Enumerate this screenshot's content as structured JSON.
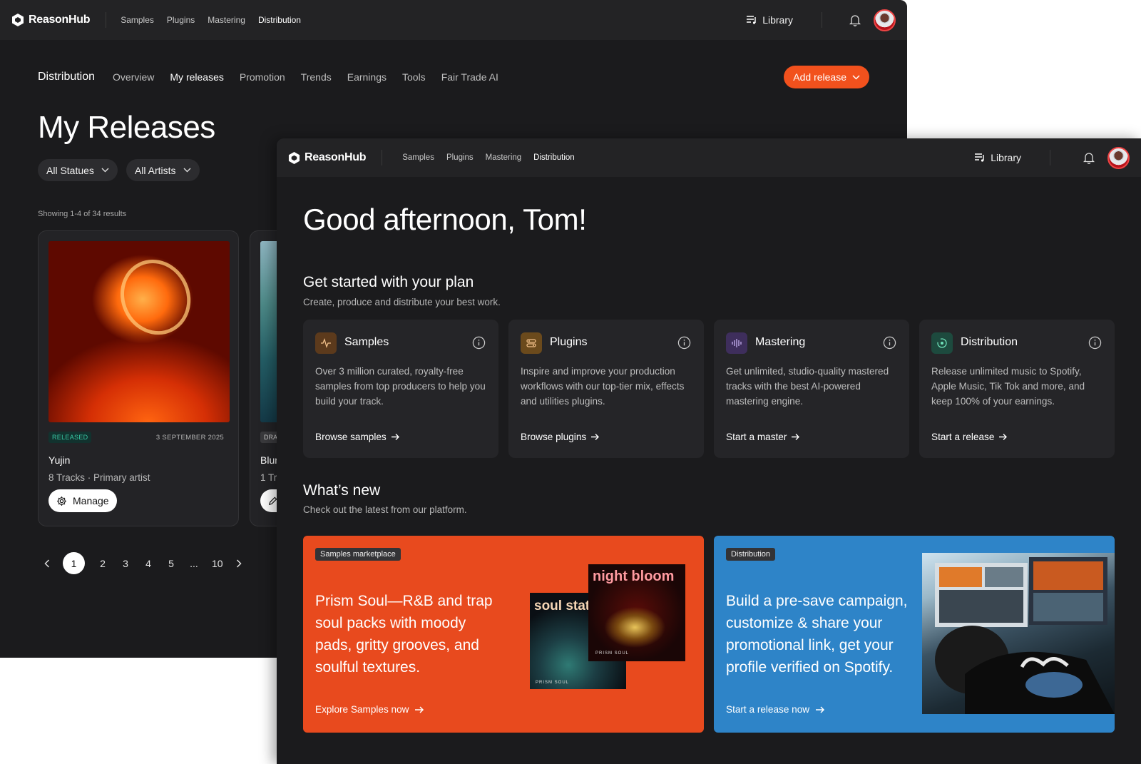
{
  "brand": "ReasonHub",
  "topnav": [
    "Samples",
    "Plugins",
    "Mastering",
    "Distribution"
  ],
  "library_label": "Library",
  "back": {
    "section": "Distribution",
    "tabs": [
      "Overview",
      "My releases",
      "Promotion",
      "Trends",
      "Earnings",
      "Tools",
      "Fair Trade AI"
    ],
    "add_release": "Add release",
    "title": "My Releases",
    "filters": [
      "All Statues",
      "All Artists"
    ],
    "showing": "Showing 1-4 of 34 results",
    "releases": [
      {
        "status": "RELEASED",
        "date": "3 SEPTEMBER 2025",
        "title": "Yujin",
        "meta": "8 Tracks ·  Primary artist",
        "action": "Manage"
      },
      {
        "status": "DRA",
        "title": "Blur",
        "meta": "1 Tr"
      }
    ],
    "pager": [
      "1",
      "2",
      "3",
      "4",
      "5",
      "...",
      "10"
    ]
  },
  "front": {
    "greeting": "Good afternoon, Tom!",
    "plan_title": "Get started with your plan",
    "plan_sub": "Create, produce and distribute your best work.",
    "products": [
      {
        "title": "Samples",
        "desc": "Over 3 million curated, royalty-free samples from top producers to help you build your track.",
        "link": "Browse samples",
        "icon": "waveform-pulse-icon",
        "color": "#5c3a1c"
      },
      {
        "title": "Plugins",
        "desc": "Inspire and improve your production workflows with our top-tier mix, effects and utilities plugins.",
        "link": "Browse plugins",
        "icon": "plugin-icon",
        "color": "#6b4a1c"
      },
      {
        "title": "Mastering",
        "desc": "Get unlimited, studio-quality mastered tracks with the best AI-powered mastering engine.",
        "link": "Start a master",
        "icon": "audio-bars-icon",
        "color": "#3e2e5c"
      },
      {
        "title": "Distribution",
        "desc": "Release unlimited music to Spotify, Apple Music, Tik Tok and more, and keep 100% of your earnings.",
        "link": "Start a release",
        "icon": "distribution-icon",
        "color": "#1d4a3e"
      }
    ],
    "new_title": "What’s new",
    "new_sub": "Check out the latest from our platform.",
    "promos": [
      {
        "tag": "Samples marketplace",
        "text": "Prism Soul—R&B and trap soul packs with moody pads, gritty grooves, and soulful textures.",
        "cta": "Explore Samples now",
        "bg": "#e84a1e",
        "albums": [
          "soul static",
          "night bloom"
        ],
        "album_caption": "PRISM SOUL"
      },
      {
        "tag": "Distribution",
        "text": "Build a pre-save campaign, customize & share your promotional link, get your profile verified on Spotify.",
        "cta": "Start a release now",
        "bg": "#2e84c8"
      }
    ]
  }
}
